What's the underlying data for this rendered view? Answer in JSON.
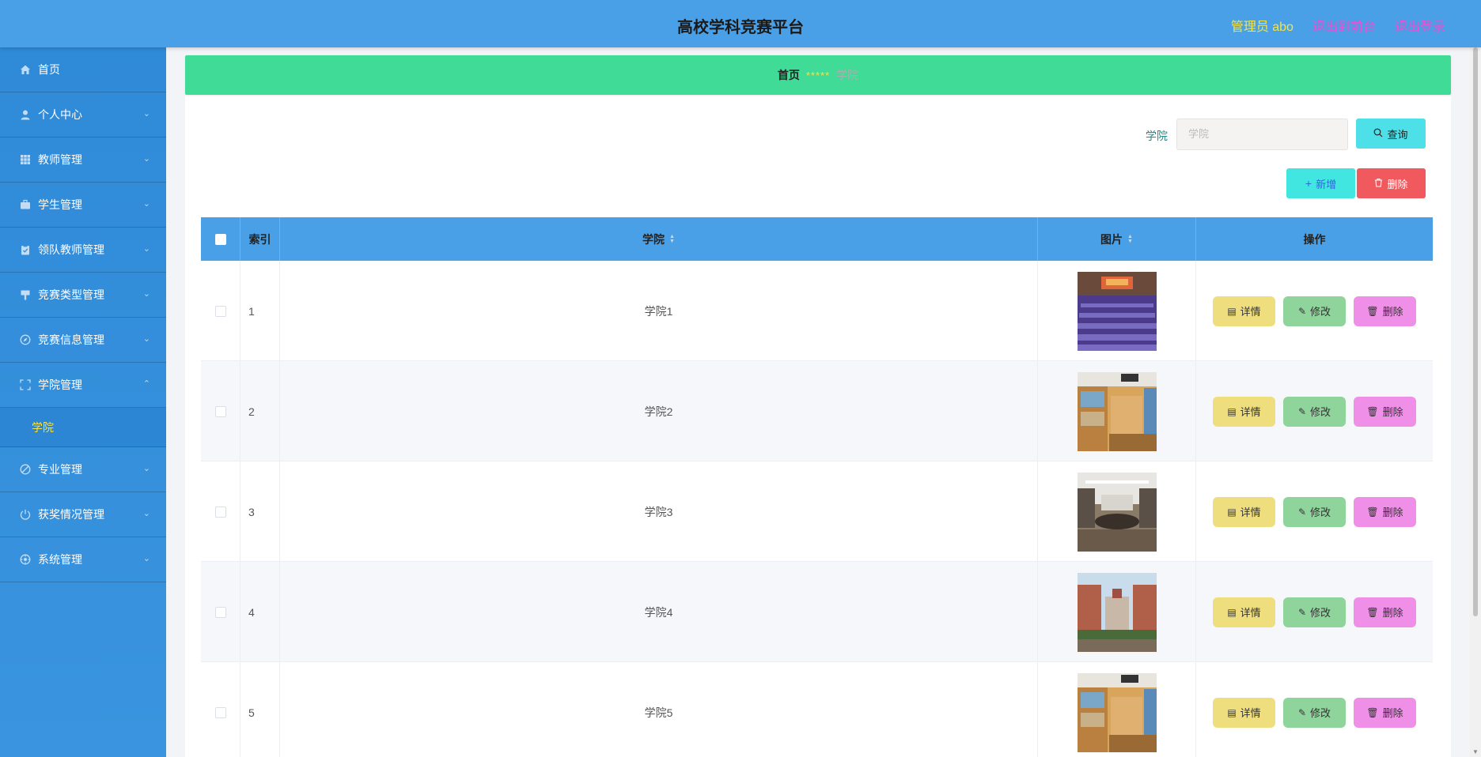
{
  "header": {
    "title": "高校学科竞赛平台",
    "admin": "管理员 abo",
    "to_front": "退出到前台",
    "logout": "退出登录"
  },
  "sidebar": {
    "items": [
      {
        "label": "首页",
        "icon": "home-icon"
      },
      {
        "label": "个人中心",
        "icon": "user-icon"
      },
      {
        "label": "教师管理",
        "icon": "grid-icon"
      },
      {
        "label": "学生管理",
        "icon": "briefcase-icon"
      },
      {
        "label": "领队教师管理",
        "icon": "clipboard-icon"
      },
      {
        "label": "竞赛类型管理",
        "icon": "flag-icon"
      },
      {
        "label": "竞赛信息管理",
        "icon": "compass-icon"
      },
      {
        "label": "学院管理",
        "icon": "expand-icon"
      },
      {
        "label": "专业管理",
        "icon": "tag-icon"
      },
      {
        "label": "获奖情况管理",
        "icon": "power-icon"
      },
      {
        "label": "系统管理",
        "icon": "settings-icon"
      }
    ],
    "sub_label": "学院"
  },
  "breadcrumb": {
    "home": "首页",
    "sep": "*****",
    "current": "学院"
  },
  "search": {
    "label": "学院",
    "placeholder": "学院",
    "query_button": "查询"
  },
  "toolbar": {
    "add": "新增",
    "delete": "删除"
  },
  "table": {
    "columns": {
      "index": "索引",
      "college": "学院",
      "image": "图片",
      "actions": "操作"
    },
    "actions": {
      "detail": "详情",
      "edit": "修改",
      "delete": "删除"
    },
    "rows": [
      {
        "index": "1",
        "college": "学院1",
        "image": "auditorium"
      },
      {
        "index": "2",
        "college": "学院2",
        "image": "dorm-room"
      },
      {
        "index": "3",
        "college": "学院3",
        "image": "meeting-room"
      },
      {
        "index": "4",
        "college": "学院4",
        "image": "campus-building"
      },
      {
        "index": "5",
        "college": "学院5",
        "image": "dorm-room"
      }
    ]
  },
  "colors": {
    "header": "#4aa0e6",
    "sidebar": "#2f8ad8",
    "breadcrumb": "#3fdb97",
    "accent_yellow": "#f3e34a",
    "accent_pink": "#e84fd2"
  }
}
